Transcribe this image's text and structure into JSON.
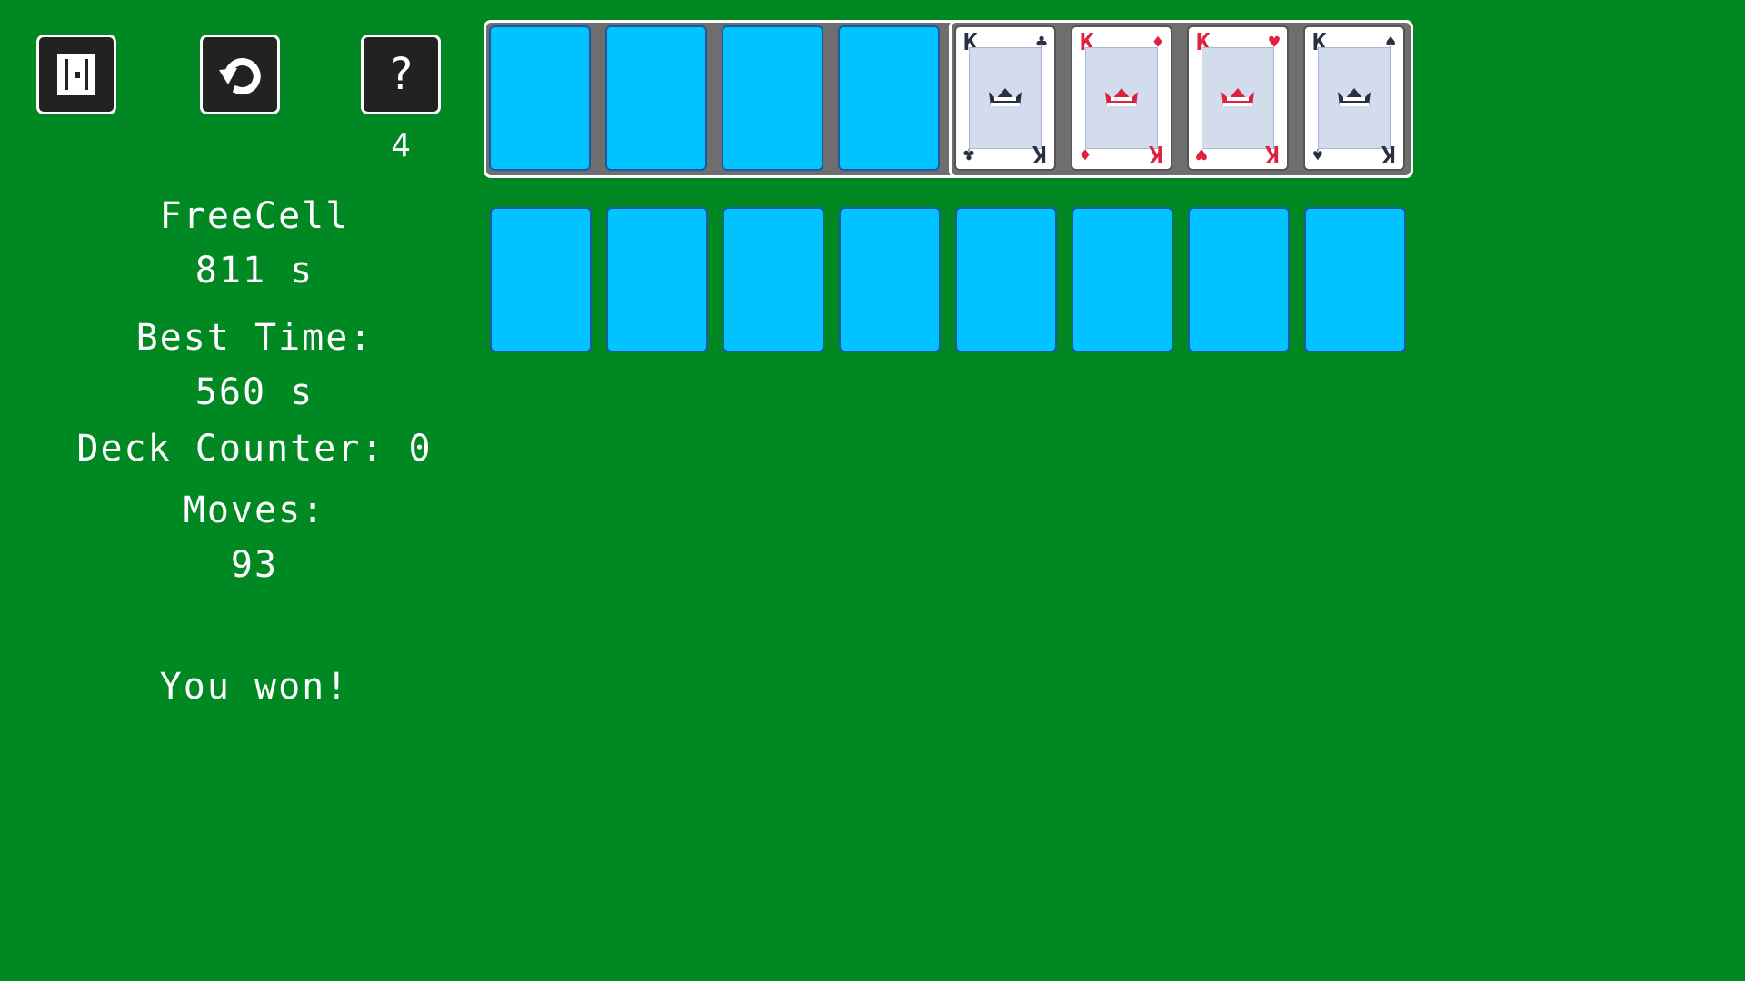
{
  "toolbar": {
    "exit_icon": "exit-door-icon",
    "undo_icon": "undo-arrow-icon",
    "help_label": "?",
    "hint_count": "4"
  },
  "info": {
    "game_name": "FreeCell",
    "elapsed": "811 s",
    "best_time_label": "Best Time:",
    "best_time_value": "560 s",
    "deck_counter": "Deck Counter: 0",
    "moves_label": "Moves:",
    "moves_value": "93",
    "status": "You won!"
  },
  "free_cells": [
    {
      "empty": true
    },
    {
      "empty": true
    },
    {
      "empty": true
    },
    {
      "empty": true
    }
  ],
  "foundations": [
    {
      "rank": "K",
      "suit": "clubs",
      "suit_symbol": "♣",
      "color": "black"
    },
    {
      "rank": "K",
      "suit": "diamonds",
      "suit_symbol": "♦",
      "color": "red"
    },
    {
      "rank": "K",
      "suit": "hearts",
      "suit_symbol": "♥",
      "color": "red"
    },
    {
      "rank": "K",
      "suit": "spades",
      "suit_symbol": "♠",
      "color": "black"
    }
  ],
  "tableau": [
    {
      "empty": true
    },
    {
      "empty": true
    },
    {
      "empty": true
    },
    {
      "empty": true
    },
    {
      "empty": true
    },
    {
      "empty": true
    },
    {
      "empty": true
    },
    {
      "empty": true
    }
  ],
  "colors": {
    "table_green": "#008822",
    "slot_blue": "#00c3ff",
    "tray_gray": "#6e6e6e",
    "button_dark": "#222222",
    "card_red": "#e02040",
    "card_black": "#2b3040"
  }
}
